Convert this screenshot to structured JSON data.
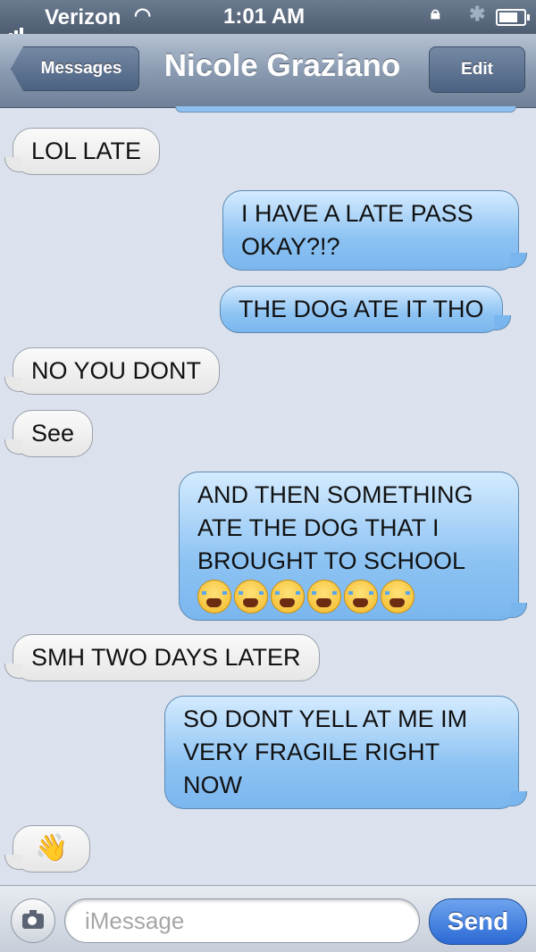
{
  "status_bar": {
    "carrier": "Verizon",
    "time": "1:01 AM",
    "battery_level": 0.9
  },
  "nav": {
    "back_label": "Messages",
    "title": "Nicole Graziano",
    "edit_label": "Edit"
  },
  "messages": [
    {
      "side": "in",
      "text": "LOL LATE"
    },
    {
      "side": "out",
      "text": "I HAVE A LATE PASS OKAY?!?"
    },
    {
      "side": "out",
      "text": "THE DOG ATE IT THO"
    },
    {
      "side": "in",
      "text": "NO YOU DONT"
    },
    {
      "side": "in",
      "text": "See"
    },
    {
      "side": "out",
      "text": "AND THEN SOMETHING ATE THE DOG THAT I BROUGHT TO SCHOOL",
      "emoji": [
        "crying-face",
        "crying-face",
        "crying-face",
        "crying-face",
        "crying-face",
        "crying-face"
      ]
    },
    {
      "side": "in",
      "text": "SMH TWO DAYS LATER"
    },
    {
      "side": "out",
      "text": "SO DONT YELL AT ME IM VERY FRAGILE RIGHT NOW"
    },
    {
      "side": "in",
      "emoji": [
        "waving-hand"
      ]
    }
  ],
  "input": {
    "placeholder": "iMessage",
    "send_label": "Send"
  },
  "colors": {
    "background": "#dbe2ed",
    "outgoing_bubble": "#8dc3f3",
    "incoming_bubble": "#f2f2f2",
    "send_button": "#2b6ad4"
  }
}
